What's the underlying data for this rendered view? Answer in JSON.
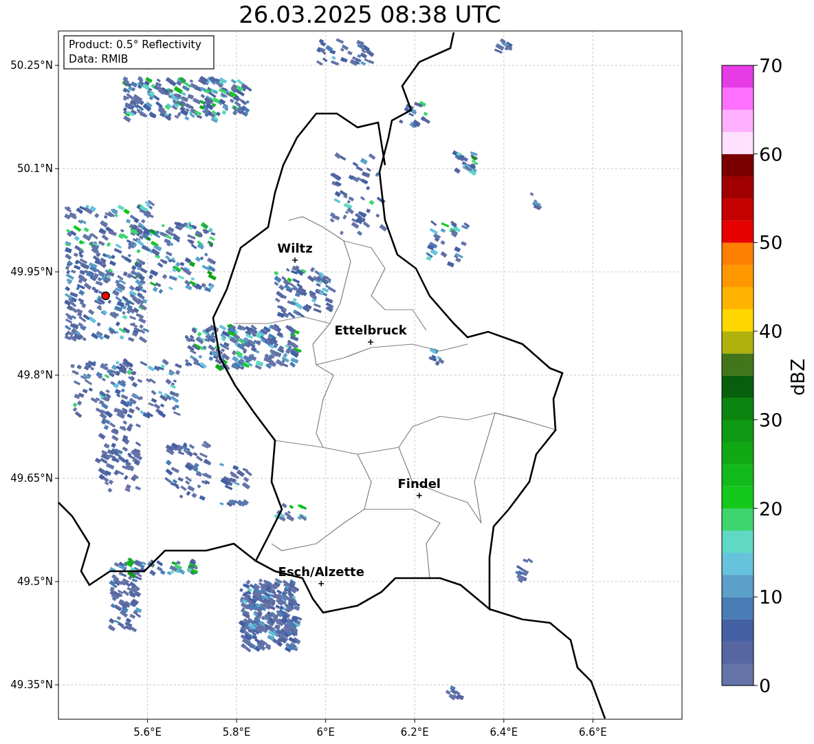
{
  "title": "26.03.2025 08:38 UTC",
  "info_box": [
    "Product: 0.5° Reflectivity",
    "Data: RMIB"
  ],
  "map": {
    "latitude_labels": [
      "50.25°N",
      "50.1°N",
      "49.95°N",
      "49.8°N",
      "49.65°N",
      "49.5°N",
      "49.35°N"
    ],
    "cities": [
      {
        "name": "Wiltz"
      },
      {
        "name": "Ettelbruck"
      },
      {
        "name": "Findel"
      },
      {
        "name": "Esch/Alzette"
      }
    ],
    "longitude_labels": [
      "5.6°E",
      "5.8°E",
      "6°E",
      "6.2°E",
      "6.4°E",
      "6.6°E"
    ]
  },
  "colorbar": {
    "label": "dBZ",
    "ticks": [
      "70",
      "60",
      "50",
      "40",
      "30",
      "20",
      "10",
      "0"
    ],
    "bands": [
      {
        "color": "#6474a8"
      },
      {
        "color": "#5566a0"
      },
      {
        "color": "#4460a3"
      },
      {
        "color": "#4a7db5"
      },
      {
        "color": "#5aa0c8"
      },
      {
        "color": "#66c2dd"
      },
      {
        "color": "#5fd8c4"
      },
      {
        "color": "#3dd66e"
      },
      {
        "color": "#14c81c"
      },
      {
        "color": "#12b91a"
      },
      {
        "color": "#10a815"
      },
      {
        "color": "#0e9a12"
      },
      {
        "color": "#0b850f"
      },
      {
        "color": "#085f0b"
      },
      {
        "color": "#43761a"
      },
      {
        "color": "#b0b10d"
      },
      {
        "color": "#ffd700"
      },
      {
        "color": "#ffb300"
      },
      {
        "color": "#ff9800"
      },
      {
        "color": "#ff7f00"
      },
      {
        "color": "#e60000"
      },
      {
        "color": "#c40000"
      },
      {
        "color": "#a00000"
      },
      {
        "color": "#7a0000"
      },
      {
        "color": "#ffe0ff"
      },
      {
        "color": "#ffb0ff"
      },
      {
        "color": "#ff70ff"
      },
      {
        "color": "#e63ce6"
      }
    ]
  }
}
